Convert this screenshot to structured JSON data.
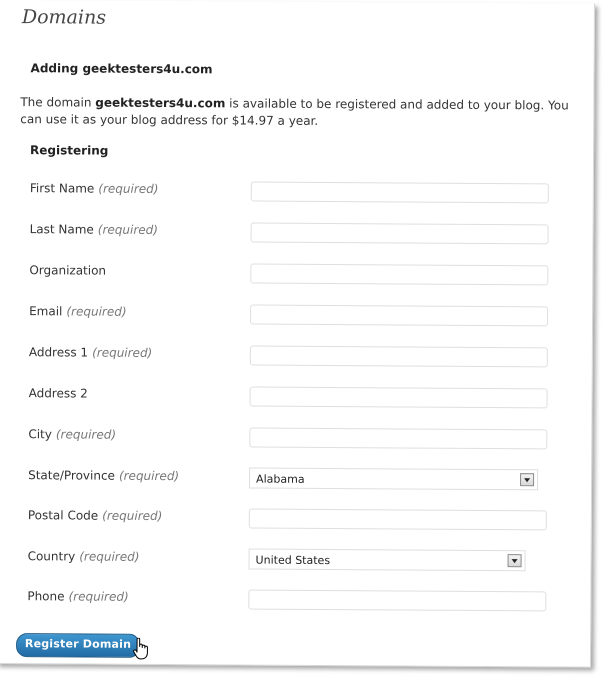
{
  "page_title": "Domains",
  "adding_heading": "Adding geektesters4u.com",
  "description": {
    "prefix": "The domain ",
    "domain": "geektesters4u.com",
    "suffix": " is available to be registered and added to your blog. You can use it as your blog address for $14.97 a year."
  },
  "registering_heading": "Registering",
  "required_text": "(required)",
  "fields": {
    "first_name": {
      "label": "First Name",
      "value": ""
    },
    "last_name": {
      "label": "Last Name",
      "value": ""
    },
    "organization": {
      "label": "Organization",
      "value": ""
    },
    "email": {
      "label": "Email",
      "value": ""
    },
    "address1": {
      "label": "Address 1",
      "value": ""
    },
    "address2": {
      "label": "Address 2",
      "value": ""
    },
    "city": {
      "label": "City",
      "value": ""
    },
    "state": {
      "label": "State/Province",
      "selected": "Alabama"
    },
    "postal_code": {
      "label": "Postal Code",
      "value": ""
    },
    "country": {
      "label": "Country",
      "selected": "United States"
    },
    "phone": {
      "label": "Phone",
      "value": ""
    }
  },
  "register_button": "Register Domain",
  "colors": {
    "button": "#2a75ad",
    "title": "#464646"
  },
  "icons": {
    "cursor": "hand-pointer-icon",
    "dropdown": "chevron-down-icon"
  }
}
